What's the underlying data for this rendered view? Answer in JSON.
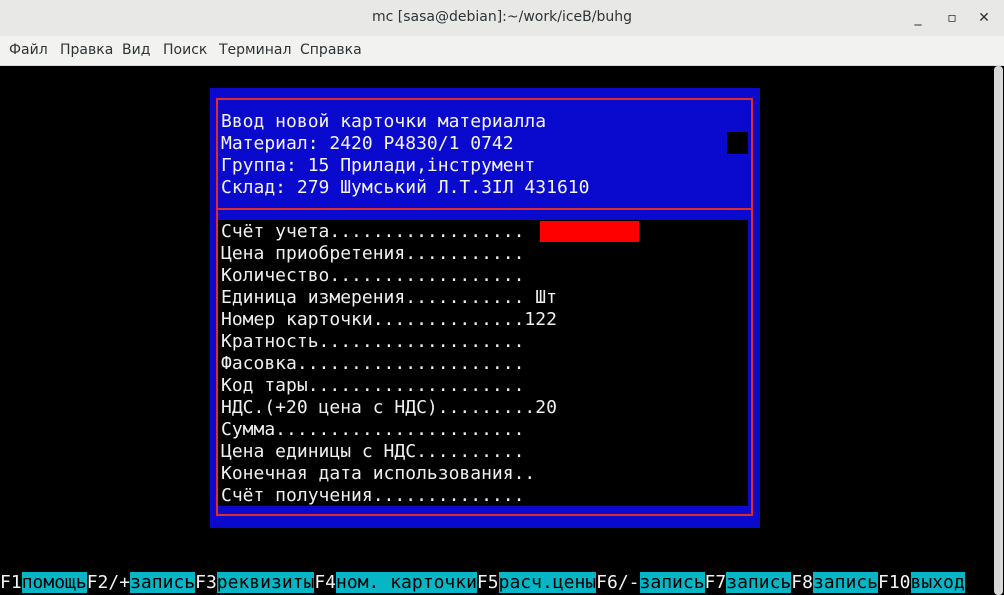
{
  "window": {
    "title": "mc [sasa@debian]:~/work/iceB/buhg",
    "minimize": "_",
    "maximize": "▫",
    "close": "✕"
  },
  "menu": [
    "Файл",
    "Правка",
    "Вид",
    "Поиск",
    "Терминал",
    "Справка"
  ],
  "dialog": {
    "title": "Ввод новой карточки материалла",
    "material": "Материал: 2420 Р4830/1 0742",
    "group": "Группа: 15 Прилади,інструмент",
    "warehouse": "Склад: 279 Шумський Л.Т.ЗІЛ 431610",
    "fields": [
      "Счёт учета..................",
      "Цена приобретения...........",
      "Количество..................",
      "Единица измерения........... Шт",
      "Номер карточки..............122",
      "Кратность...................",
      "Фасовка.....................",
      "Код тары....................",
      "НДС.(+20 цена с НДС).........20",
      "Сумма.......................",
      "Цена единицы с НДС..........",
      "Конечная дата использования..",
      "Счёт получения.............."
    ]
  },
  "function_keys": [
    {
      "key": "F1",
      "label": "помощь"
    },
    {
      "key": "F2/+",
      "label": "запись"
    },
    {
      "key": "F3",
      "label": "реквизиты"
    },
    {
      "key": "F4",
      "label": "ном. карточки"
    },
    {
      "key": "F5",
      "label": "расч.цены"
    },
    {
      "key": "F6/-",
      "label": "запись"
    },
    {
      "key": "F7",
      "label": "запись"
    },
    {
      "key": "F8",
      "label": "запись"
    },
    {
      "key": "F10",
      "label": "выход"
    }
  ],
  "colors": {
    "dialog_bg": "#0a0acf",
    "frame": "#e02a2a",
    "input_highlight": "#ff0000",
    "fkey_label_bg": "#06b5c6"
  }
}
